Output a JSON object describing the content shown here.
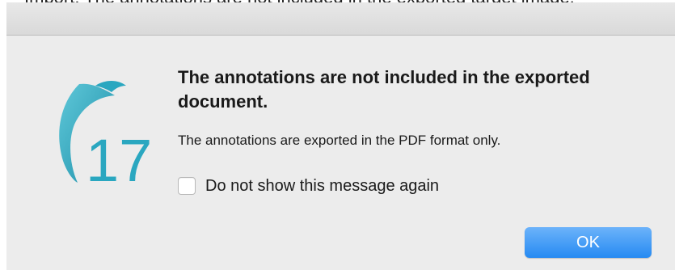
{
  "background_text": "Import: The annotations are not included in the exported target image.",
  "dialog": {
    "icon": {
      "name": "app-logo-icon",
      "text": "17",
      "color": "#2aa7c0"
    },
    "headline": "The annotations are not included in the exported document.",
    "message": "The annotations are exported in the PDF format only.",
    "checkbox": {
      "label": "Do not show this message again",
      "checked": false
    },
    "ok_label": "OK",
    "accent_color": "#268af2"
  }
}
